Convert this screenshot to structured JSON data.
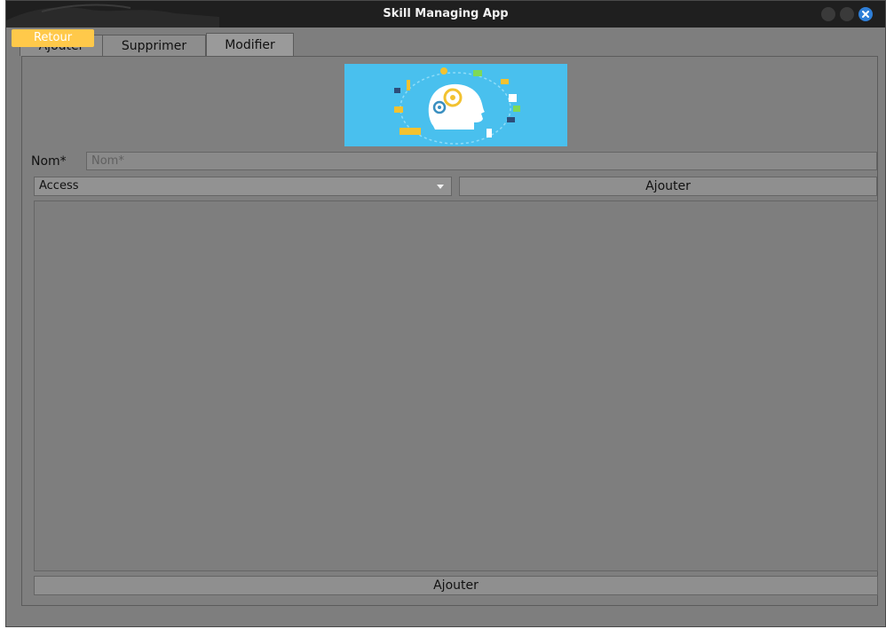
{
  "window": {
    "title": "Skill Managing App"
  },
  "retour_label": "Retour",
  "tabs": [
    {
      "label": "Ajouter"
    },
    {
      "label": "Supprimer"
    },
    {
      "label": "Modifier"
    }
  ],
  "form": {
    "nom_label": "Nom*",
    "nom_placeholder": "Nom*",
    "nom_value": "",
    "category_selected": "Access",
    "add_button": "Ajouter"
  },
  "footer": {
    "add_button": "Ajouter"
  },
  "colors": {
    "accent": "#ffc94a",
    "close": "#2f7fd8",
    "hero_bg": "#49c0ee"
  }
}
